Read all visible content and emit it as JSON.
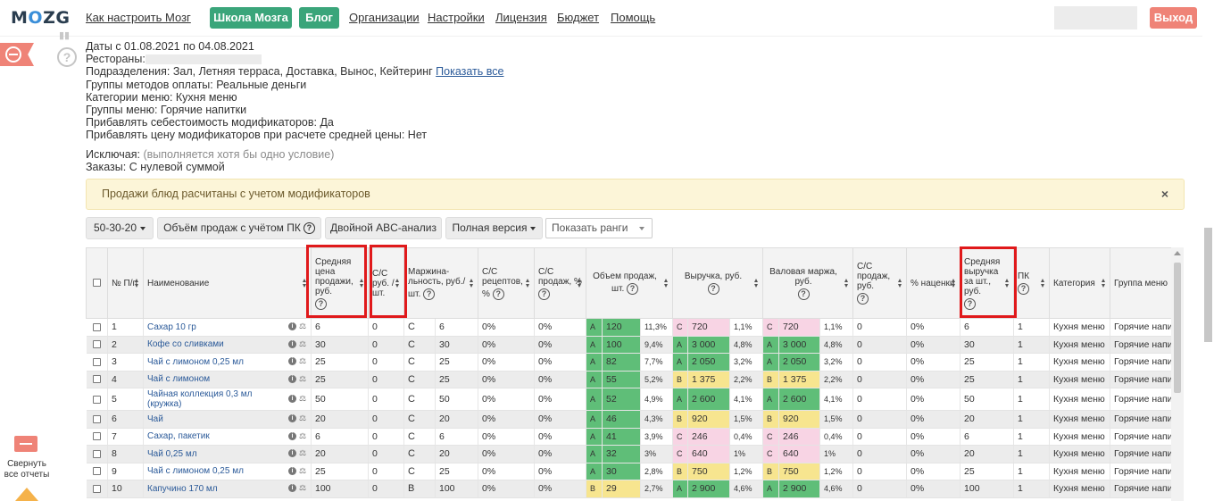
{
  "header": {
    "logo_a": "M",
    "logo_o": "O",
    "logo_b": "ZG",
    "nav": [
      "Как настроить Мозг",
      "Школа Мозга",
      "Блог",
      "Организации",
      "Настройки",
      "Лицензия",
      "Бюджет",
      "Помощь"
    ],
    "logout": "Выход"
  },
  "sidebar": {
    "collapse_label": "Свернуть все отчеты"
  },
  "filters": {
    "dates": "Даты с 01.08.2021 по 04.08.2021",
    "restaurants": "Рестораны:",
    "departments": "Подразделения: Зал, Летняя терраса, Доставка, Вынос, Кейтеринг",
    "show_all": "Показать все",
    "payment_groups": "Группы методов оплаты: Реальные деньги",
    "menu_categories": "Категории меню: Кухня меню",
    "menu_groups": "Группы меню: Горячие напитки",
    "add_cost": "Прибавлять себестоимость модификаторов: Да",
    "add_price": "Прибавлять цену модификаторов при расчете средней цены: Нет",
    "exclude": "Исключая:",
    "exclude_note": "(выполняется хотя бы одно условие)",
    "orders": "Заказы: С нулевой суммой"
  },
  "alert": {
    "text": "Продажи блюд расчитаны с учетом модификаторов",
    "close": "×"
  },
  "toolbar": {
    "ratio": "50-30-20",
    "volume": "Объём продаж с учётом ПК",
    "double_abc": "Двойной ABC-анализ",
    "full": "Полная версия",
    "ranks_placeholder": "Показать ранги"
  },
  "table": {
    "headers": {
      "num": "№ П/п",
      "name": "Наименование",
      "avg_price": "Средняя цена продажи, руб.",
      "cost": "С/С руб. /шт.",
      "margin": "Маржина- льность, руб./шт.",
      "cost_recipe": "С/С рецептов, %",
      "cost_sales": "С/С продаж, %",
      "volume": "Объем продаж, шт.",
      "revenue": "Выручка, руб.",
      "gross": "Валовая маржа, руб.",
      "cost_sales2": "С/С продаж, руб.",
      "markup": "% наценки",
      "avg_rev": "Средняя выручка за шт., руб.",
      "pk": "ПК",
      "category": "Категория",
      "group": "Группа меню"
    },
    "rows": [
      {
        "n": "1",
        "name": "Сахар 10 гр",
        "price": "6",
        "cost": "0",
        "mcls": "C",
        "margin": "6",
        "cr": "0%",
        "cs": "0%",
        "vcls": "A",
        "vol": "120",
        "vp": "11,3%",
        "rcls": "C",
        "rev": "720",
        "rp": "1,1%",
        "gcls": "C",
        "gm": "720",
        "gp": "1,1%",
        "cs2": "0",
        "mk": "0%",
        "ar": "6",
        "pk": "1",
        "cat": "Кухня меню",
        "grp": "Горячие напи"
      },
      {
        "n": "2",
        "name": "Кофе со сливками",
        "price": "30",
        "cost": "0",
        "mcls": "C",
        "margin": "30",
        "cr": "0%",
        "cs": "0%",
        "vcls": "A",
        "vol": "100",
        "vp": "9,4%",
        "rcls": "A",
        "rev": "3 000",
        "rp": "4,8%",
        "gcls": "A",
        "gm": "3 000",
        "gp": "4,8%",
        "cs2": "0",
        "mk": "0%",
        "ar": "30",
        "pk": "1",
        "cat": "Кухня меню",
        "grp": "Горячие напи"
      },
      {
        "n": "3",
        "name": "Чай с лимоном 0,25 мл",
        "price": "25",
        "cost": "0",
        "mcls": "C",
        "margin": "25",
        "cr": "0%",
        "cs": "0%",
        "vcls": "A",
        "vol": "82",
        "vp": "7,7%",
        "rcls": "A",
        "rev": "2 050",
        "rp": "3,2%",
        "gcls": "A",
        "gm": "2 050",
        "gp": "3,2%",
        "cs2": "0",
        "mk": "0%",
        "ar": "25",
        "pk": "1",
        "cat": "Кухня меню",
        "grp": "Горячие напи"
      },
      {
        "n": "4",
        "name": "Чай с лимоном",
        "price": "25",
        "cost": "0",
        "mcls": "C",
        "margin": "25",
        "cr": "0%",
        "cs": "0%",
        "vcls": "A",
        "vol": "55",
        "vp": "5,2%",
        "rcls": "B",
        "rev": "1 375",
        "rp": "2,2%",
        "gcls": "B",
        "gm": "1 375",
        "gp": "2,2%",
        "cs2": "0",
        "mk": "0%",
        "ar": "25",
        "pk": "1",
        "cat": "Кухня меню",
        "grp": "Горячие напи"
      },
      {
        "n": "5",
        "name": "Чайная коллекция 0,3 мл (кружка)",
        "price": "50",
        "cost": "0",
        "mcls": "C",
        "margin": "50",
        "cr": "0%",
        "cs": "0%",
        "vcls": "A",
        "vol": "52",
        "vp": "4,9%",
        "rcls": "A",
        "rev": "2 600",
        "rp": "4,1%",
        "gcls": "A",
        "gm": "2 600",
        "gp": "4,1%",
        "cs2": "0",
        "mk": "0%",
        "ar": "50",
        "pk": "1",
        "cat": "Кухня меню",
        "grp": "Горячие напи"
      },
      {
        "n": "6",
        "name": "Чай",
        "price": "20",
        "cost": "0",
        "mcls": "C",
        "margin": "20",
        "cr": "0%",
        "cs": "0%",
        "vcls": "A",
        "vol": "46",
        "vp": "4,3%",
        "rcls": "B",
        "rev": "920",
        "rp": "1,5%",
        "gcls": "B",
        "gm": "920",
        "gp": "1,5%",
        "cs2": "0",
        "mk": "0%",
        "ar": "20",
        "pk": "1",
        "cat": "Кухня меню",
        "grp": "Горячие напи"
      },
      {
        "n": "7",
        "name": "Сахар, пакетик",
        "price": "6",
        "cost": "0",
        "mcls": "C",
        "margin": "6",
        "cr": "0%",
        "cs": "0%",
        "vcls": "A",
        "vol": "41",
        "vp": "3,9%",
        "rcls": "C",
        "rev": "246",
        "rp": "0,4%",
        "gcls": "C",
        "gm": "246",
        "gp": "0,4%",
        "cs2": "0",
        "mk": "0%",
        "ar": "6",
        "pk": "1",
        "cat": "Кухня меню",
        "grp": "Горячие напи"
      },
      {
        "n": "8",
        "name": "Чай 0,25 мл",
        "price": "20",
        "cost": "0",
        "mcls": "C",
        "margin": "20",
        "cr": "0%",
        "cs": "0%",
        "vcls": "A",
        "vol": "32",
        "vp": "3%",
        "rcls": "C",
        "rev": "640",
        "rp": "1%",
        "gcls": "C",
        "gm": "640",
        "gp": "1%",
        "cs2": "0",
        "mk": "0%",
        "ar": "20",
        "pk": "1",
        "cat": "Кухня меню",
        "grp": "Горячие напи"
      },
      {
        "n": "9",
        "name": "Чай с лимоном 0,25 мл",
        "price": "25",
        "cost": "0",
        "mcls": "C",
        "margin": "25",
        "cr": "0%",
        "cs": "0%",
        "vcls": "A",
        "vol": "30",
        "vp": "2,8%",
        "rcls": "B",
        "rev": "750",
        "rp": "1,2%",
        "gcls": "B",
        "gm": "750",
        "gp": "1,2%",
        "cs2": "0",
        "mk": "0%",
        "ar": "25",
        "pk": "1",
        "cat": "Кухня меню",
        "grp": "Горячие напи"
      },
      {
        "n": "10",
        "name": "Капучино 170 мл",
        "price": "100",
        "cost": "0",
        "mcls": "B",
        "margin": "100",
        "cr": "0%",
        "cs": "0%",
        "vcls": "B",
        "vol": "29",
        "vp": "2,7%",
        "rcls": "A",
        "rev": "2 900",
        "rp": "4,6%",
        "gcls": "A",
        "gm": "2 900",
        "gp": "4,6%",
        "cs2": "0",
        "mk": "0%",
        "ar": "100",
        "pk": "1",
        "cat": "Кухня меню",
        "grp": "Горячие напи"
      }
    ]
  },
  "colors": {
    "brand_green": "#3aa57a",
    "logout_red": "#ef8377",
    "class_A": "#5fbe78",
    "class_B": "#f7e58f",
    "class_C": "#f8d4e4",
    "highlight_red": "#e0191b"
  }
}
